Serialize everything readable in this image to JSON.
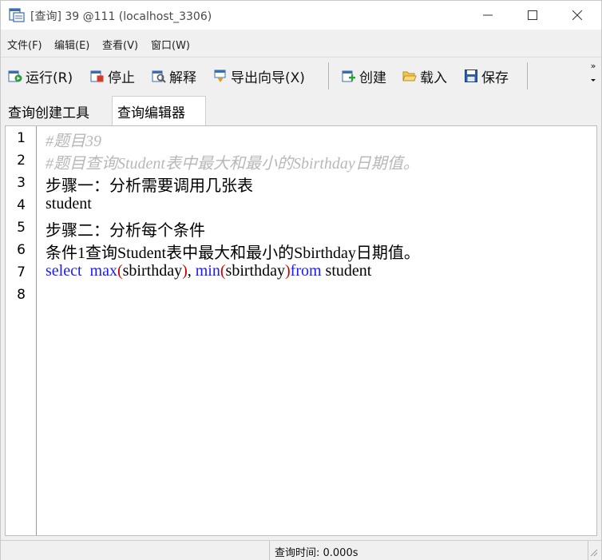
{
  "window": {
    "title": "[查询] 39 @111 (localhost_3306)",
    "controls": {
      "minimize": "—",
      "maximize": "☐",
      "close": "✕"
    }
  },
  "menu": {
    "items": [
      "文件(F)",
      "编辑(E)",
      "查看(V)",
      "窗口(W)"
    ]
  },
  "toolbar": {
    "run": "运行(R)",
    "stop": "停止",
    "explain": "解释",
    "export_wizard": "导出向导(X)",
    "create": "创建",
    "load": "载入",
    "save": "保存",
    "overflow": "»"
  },
  "tabs": [
    {
      "label": "查询创建工具",
      "active": false
    },
    {
      "label": "查询编辑器",
      "active": true
    }
  ],
  "editor": {
    "line_numbers": [
      "1",
      "2",
      "3",
      "4",
      "5",
      "6",
      "7",
      "8"
    ],
    "lines": {
      "l1": "#题目39",
      "l2": "#题目查询Student表中最大和最小的Sbirthday日期值。",
      "l3": "步骤一：分析需要调用几张表",
      "l4": "student",
      "l5": "步骤二：分析每个条件",
      "l6": "条件1查询Student表中最大和最小的Sbirthday日期值。",
      "l7": {
        "select": "select",
        "max": "max",
        "open1": "(",
        "arg1": "sbirthday",
        "close1": ")",
        "comma": ",",
        "min": "min",
        "open2": "(",
        "arg2": "sbirthday",
        "close2": ")",
        "from": "from",
        "table": "student"
      }
    },
    "colors": {
      "comment": "#b8b8b8",
      "keyword": "#1a1aff",
      "paren": "#c80000"
    }
  },
  "status": {
    "query_time": "查询时间: 0.000s"
  }
}
